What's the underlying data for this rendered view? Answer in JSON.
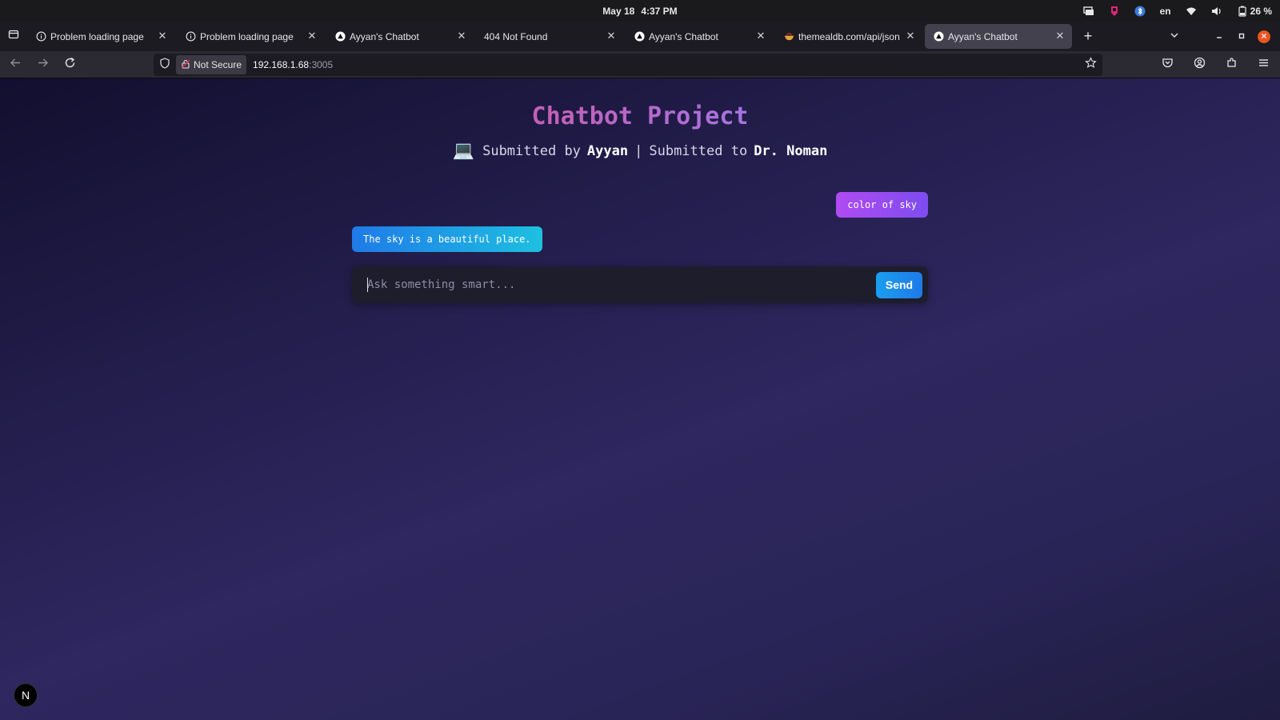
{
  "os": {
    "date": "May 18",
    "time": "4:37 PM",
    "lang": "en",
    "battery": "26 %"
  },
  "tabs": [
    {
      "title": "Problem loading page",
      "icon": "info-icon",
      "active": false
    },
    {
      "title": "Problem loading page",
      "icon": "info-icon",
      "active": false
    },
    {
      "title": "Ayyan's Chatbot",
      "icon": "triangle-logo-icon",
      "active": false
    },
    {
      "title": "404 Not Found",
      "icon": "",
      "active": false
    },
    {
      "title": "Ayyan's Chatbot",
      "icon": "triangle-logo-icon",
      "active": false
    },
    {
      "title": "themealdb.com/api/json/v",
      "icon": "bowl-icon",
      "active": false
    },
    {
      "title": "Ayyan's Chatbot",
      "icon": "triangle-logo-icon",
      "active": true
    }
  ],
  "navbar": {
    "security_label": "Not Secure",
    "url_host": "192.168.1.68",
    "url_port": ":3005"
  },
  "page": {
    "title": "Chatbot Project",
    "subtitle_icon": "💻",
    "submitted_by_label": "Submitted by",
    "author": "Ayyan",
    "separator": "|",
    "submitted_to_label": "Submitted to",
    "instructor": "Dr. Noman"
  },
  "chat": {
    "messages": [
      {
        "role": "user",
        "text": "color of sky"
      },
      {
        "role": "bot",
        "text": "The sky is a beautiful place."
      }
    ],
    "input_placeholder": "Ask something smart...",
    "input_value": "",
    "send_label": "Send"
  },
  "dev_badge": "N",
  "colors": {
    "accent_user": "#b04bf2",
    "accent_bot": "#1f7ae8",
    "send": "#1a9ef0",
    "title_gradient_start": "#c45fb4",
    "title_gradient_end": "#a673e0"
  }
}
